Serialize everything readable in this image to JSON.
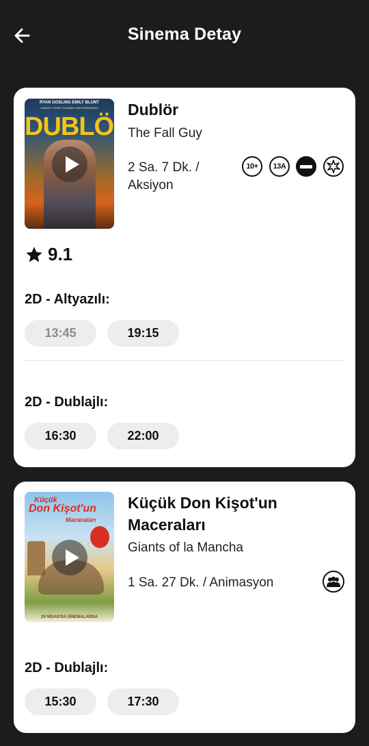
{
  "header": {
    "title": "Sinema Detay",
    "back_icon": "arrow-left-icon"
  },
  "movies": [
    {
      "title": "Dublör",
      "original_title": "The Fall Guy",
      "duration": "2 Sa. 7 Dk. /",
      "genre": "Aksiyon",
      "rating": "9.1",
      "badges": [
        "10+",
        "13A",
        "no-entry-icon",
        "violence-icon"
      ],
      "poster": {
        "top_text": "RYAN GOSLING    EMILY BLUNT",
        "sub_text": "SUİKAST TRENİ FİLMİNİN YÖNETMENİNDEN",
        "logo": "DUBLÖR"
      },
      "sessions": [
        {
          "label": "2D - Altyazılı:",
          "times": [
            {
              "time": "13:45",
              "past": true
            },
            {
              "time": "19:15",
              "past": false
            }
          ]
        },
        {
          "label": "2D - Dublajlı:",
          "times": [
            {
              "time": "16:30",
              "past": false
            },
            {
              "time": "22:00",
              "past": false
            }
          ]
        }
      ]
    },
    {
      "title": "Küçük Don Kişot'un Maceraları",
      "original_title": "Giants of la Mancha",
      "duration": "1 Sa. 27 Dk. / Animasyon",
      "badges": [
        "general-audience-icon"
      ],
      "poster": {
        "logo_line1": "Küçük",
        "logo_line2": "Don Kişot'un",
        "logo_line3": "Maceraları",
        "bottom_text": "26 NİSAN'DA SİNEMALARDA"
      },
      "sessions": [
        {
          "label": "2D - Dublajlı:",
          "times": [
            {
              "time": "15:30",
              "past": false
            },
            {
              "time": "17:30",
              "past": false
            }
          ]
        }
      ]
    }
  ]
}
